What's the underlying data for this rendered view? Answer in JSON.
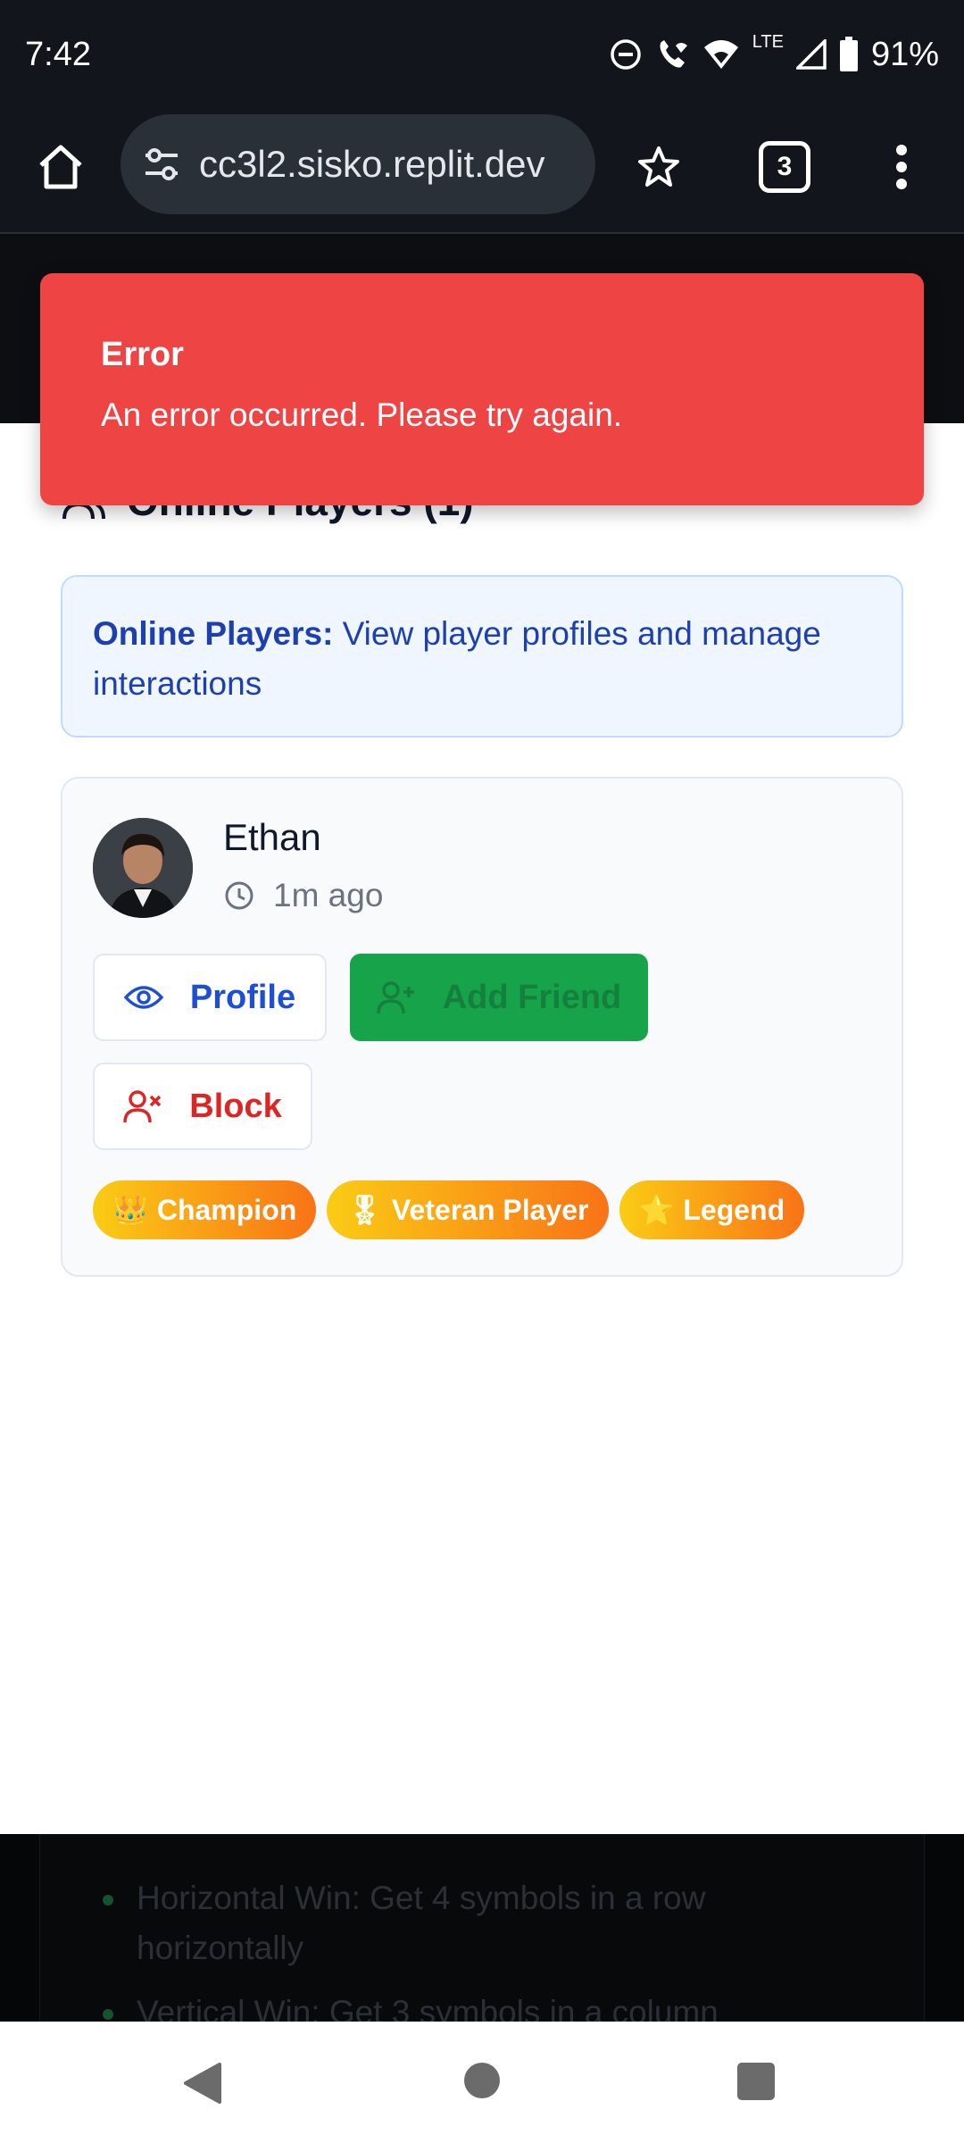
{
  "status_bar": {
    "time": "7:42",
    "network": "LTE",
    "battery": "91%",
    "icons": [
      "do-not-disturb-icon",
      "wifi-calling-icon",
      "wifi-icon",
      "cell-signal-icon",
      "battery-icon"
    ]
  },
  "browser": {
    "url": "cc3l2.sisko.replit.dev",
    "tab_count": "3",
    "icons": [
      "home-icon",
      "tune-icon",
      "star-icon",
      "more-vert-icon"
    ]
  },
  "toast": {
    "title": "Error",
    "message": "An error occurred. Please try again.",
    "color": "#ef4444"
  },
  "main": {
    "section_title": "Online Players (1)",
    "info": {
      "label": "Online Players:",
      "text": " View player profiles and manage interactions"
    },
    "player": {
      "name": "Ethan",
      "last_seen": "1m ago",
      "buttons": {
        "profile": "Profile",
        "add_friend": "Add Friend",
        "block": "Block"
      },
      "badges": [
        {
          "emoji": "👑",
          "label": "Champion"
        },
        {
          "emoji": "🎖",
          "label": "Veteran Player"
        },
        {
          "emoji": "⭐",
          "label": "Legend"
        }
      ]
    }
  },
  "rules": [
    "Horizontal Win: Get 4 symbols in a row horizontally",
    "Vertical Win: Get 3 symbols in a column"
  ],
  "colors": {
    "info_bg": "#eff6ff",
    "info_text": "#1e40af",
    "add_friend_bg": "#16a34a",
    "block": "#dc2626",
    "badge_gradient_start": "#facc15",
    "badge_gradient_end": "#f97316"
  }
}
